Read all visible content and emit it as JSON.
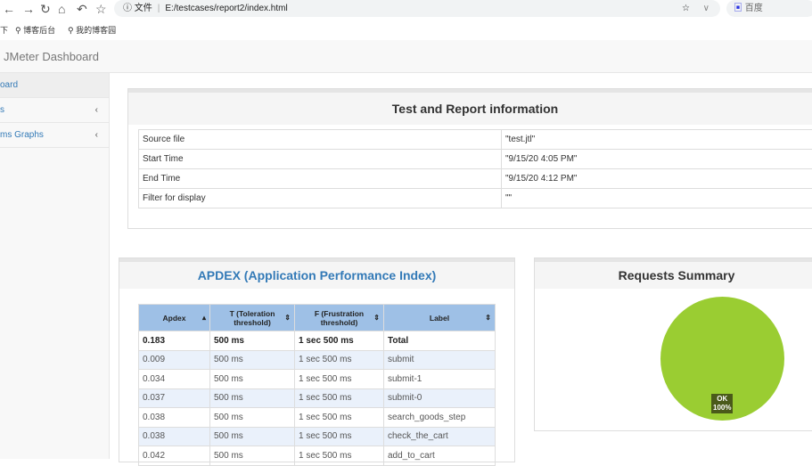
{
  "browser": {
    "url_prefix": "文件",
    "url": "E:/testcases/report2/index.html",
    "search": "百度",
    "bookmarks": [
      "下",
      "博客后台",
      "我的博客园"
    ]
  },
  "header": {
    "title": "JMeter Dashboard"
  },
  "sidebar": {
    "items": [
      {
        "label": "oard"
      },
      {
        "label": "s"
      },
      {
        "label": "ms Graphs"
      }
    ]
  },
  "info": {
    "title": "Test and Report information",
    "rows": [
      [
        "Source file",
        "\"test.jtl\""
      ],
      [
        "Start Time",
        "\"9/15/20 4:05 PM\""
      ],
      [
        "End Time",
        "\"9/15/20 4:12 PM\""
      ],
      [
        "Filter for display",
        "\"\""
      ]
    ]
  },
  "apdex": {
    "title": "APDEX (Application Performance Index)",
    "headers": [
      "Apdex",
      "T (Toleration threshold)",
      "F (Frustration threshold)",
      "Label"
    ],
    "rows": [
      [
        "0.183",
        "500 ms",
        "1 sec 500 ms",
        "Total"
      ],
      [
        "0.009",
        "500 ms",
        "1 sec 500 ms",
        "submit"
      ],
      [
        "0.034",
        "500 ms",
        "1 sec 500 ms",
        "submit-1"
      ],
      [
        "0.037",
        "500 ms",
        "1 sec 500 ms",
        "submit-0"
      ],
      [
        "0.038",
        "500 ms",
        "1 sec 500 ms",
        "search_goods_step"
      ],
      [
        "0.038",
        "500 ms",
        "1 sec 500 ms",
        "check_the_cart"
      ],
      [
        "0.042",
        "500 ms",
        "1 sec 500 ms",
        "add_to_cart"
      ]
    ]
  },
  "summary": {
    "title": "Requests Summary",
    "slice_label": "OK",
    "slice_pct": "100%",
    "ok_fraction": 1.0,
    "color": "#9acd32"
  }
}
